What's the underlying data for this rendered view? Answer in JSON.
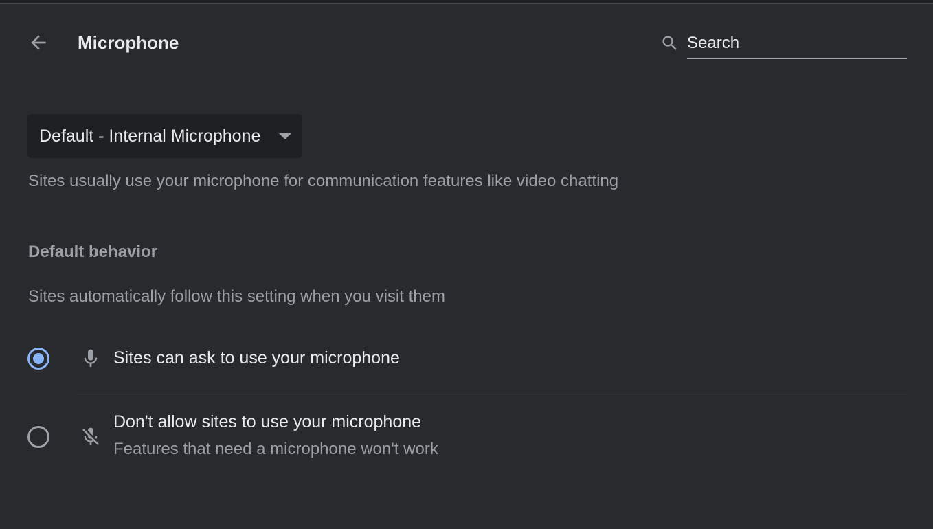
{
  "header": {
    "title": "Microphone",
    "back_icon": "arrow-back-icon",
    "search": {
      "placeholder": "Search",
      "value": "",
      "icon": "search-icon"
    }
  },
  "device_select": {
    "selected": "Default - Internal Microphone",
    "caret_icon": "caret-down-icon"
  },
  "description": "Sites usually use your microphone for communication features like video chatting",
  "default_behavior": {
    "heading": "Default behavior",
    "subtext": "Sites automatically follow this setting when you visit them",
    "options": [
      {
        "label": "Sites can ask to use your microphone",
        "sublabel": "",
        "icon": "microphone-icon",
        "selected": true
      },
      {
        "label": "Don't allow sites to use your microphone",
        "sublabel": "Features that need a microphone won't work",
        "icon": "microphone-off-icon",
        "selected": false
      }
    ]
  },
  "colors": {
    "background": "#292a2d",
    "accent": "#8ab4f8",
    "text_primary": "#e8eaed",
    "text_secondary": "#9aa0a6"
  }
}
